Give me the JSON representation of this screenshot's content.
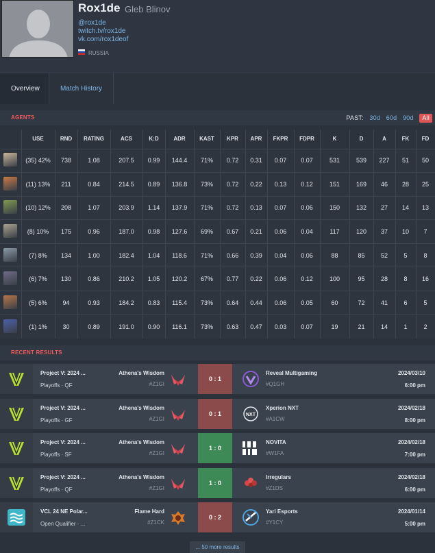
{
  "player": {
    "handle": "Rox1de",
    "real_name": "Gleb Blinov",
    "links": [
      "@rox1de",
      "twitch.tv/rox1de",
      "vk.com/rox1deof"
    ],
    "country": "RUSSIA"
  },
  "tabs": [
    {
      "label": "Overview",
      "active": true
    },
    {
      "label": "Match History",
      "active": false
    }
  ],
  "agents_section": {
    "title": "AGENTS",
    "past_label": "PAST:",
    "past_options": [
      "30d",
      "60d",
      "90d",
      "All"
    ],
    "selected": "All",
    "columns": [
      "USE",
      "RND",
      "RATING",
      "ACS",
      "K:D",
      "ADR",
      "KAST",
      "KPR",
      "APR",
      "FKPR",
      "FDPR",
      "K",
      "D",
      "A",
      "FK",
      "FD"
    ],
    "rows": [
      {
        "icon": "agent-1-icon",
        "color": "#c9b79a",
        "cells": [
          "(35) 42%",
          "738",
          "1.08",
          "207.5",
          "0.99",
          "144.4",
          "71%",
          "0.72",
          "0.31",
          "0.07",
          "0.07",
          "531",
          "539",
          "227",
          "51",
          "50"
        ]
      },
      {
        "icon": "agent-2-icon",
        "color": "#c97a45",
        "cells": [
          "(11) 13%",
          "211",
          "0.84",
          "214.5",
          "0.89",
          "136.8",
          "73%",
          "0.72",
          "0.22",
          "0.13",
          "0.12",
          "151",
          "169",
          "46",
          "28",
          "25"
        ]
      },
      {
        "icon": "agent-3-icon",
        "color": "#7f9a4f",
        "cells": [
          "(10) 12%",
          "208",
          "1.07",
          "203.9",
          "1.14",
          "137.9",
          "71%",
          "0.72",
          "0.13",
          "0.07",
          "0.06",
          "150",
          "132",
          "27",
          "14",
          "13"
        ]
      },
      {
        "icon": "agent-4-icon",
        "color": "#a9a28f",
        "cells": [
          "(8) 10%",
          "175",
          "0.96",
          "187.0",
          "0.98",
          "127.6",
          "69%",
          "0.67",
          "0.21",
          "0.06",
          "0.04",
          "117",
          "120",
          "37",
          "10",
          "7"
        ]
      },
      {
        "icon": "agent-5-icon",
        "color": "#8a9aa8",
        "cells": [
          "(7) 8%",
          "134",
          "1.00",
          "182.4",
          "1.04",
          "118.6",
          "71%",
          "0.66",
          "0.39",
          "0.04",
          "0.06",
          "88",
          "85",
          "52",
          "5",
          "8"
        ]
      },
      {
        "icon": "agent-6-icon",
        "color": "#6f6a86",
        "cells": [
          "(6) 7%",
          "130",
          "0.86",
          "210.2",
          "1.05",
          "120.2",
          "67%",
          "0.77",
          "0.22",
          "0.06",
          "0.12",
          "100",
          "95",
          "28",
          "8",
          "16"
        ]
      },
      {
        "icon": "agent-7-icon",
        "color": "#b7764a",
        "cells": [
          "(5) 6%",
          "94",
          "0.93",
          "184.2",
          "0.83",
          "115.4",
          "73%",
          "0.64",
          "0.44",
          "0.06",
          "0.05",
          "60",
          "72",
          "41",
          "6",
          "5"
        ]
      },
      {
        "icon": "agent-8-icon",
        "color": "#4c5fa8",
        "cells": [
          "(1) 1%",
          "30",
          "0.89",
          "191.0",
          "0.90",
          "116.1",
          "73%",
          "0.63",
          "0.47",
          "0.03",
          "0.07",
          "19",
          "21",
          "14",
          "1",
          "2"
        ]
      }
    ]
  },
  "results_section": {
    "title": "RECENT RESULTS",
    "results": [
      {
        "event": "Project V: 2024 ...",
        "stage": "Playoffs · QF",
        "team": "Athena's Wisdom",
        "team_tag": "#Z1GI",
        "score": "0 : 1",
        "outcome": "loss",
        "opponent": "Reveal Multigaming",
        "opp_tag": "#Q1GH",
        "date": "2024/03/10",
        "time": "6:00 pm",
        "event_logo": "project-v-logo",
        "opp_logo": "reveal-logo"
      },
      {
        "event": "Project V: 2024 ...",
        "stage": "Playoffs · GF",
        "team": "Athena's Wisdom",
        "team_tag": "#Z1GI",
        "score": "0 : 1",
        "outcome": "loss",
        "opponent": "Xperion NXT",
        "opp_tag": "#A1CW",
        "date": "2024/02/18",
        "time": "8:00 pm",
        "event_logo": "project-v-logo",
        "opp_logo": "nxt-logo"
      },
      {
        "event": "Project V: 2024 ...",
        "stage": "Playoffs · SF",
        "team": "Athena's Wisdom",
        "team_tag": "#Z1GI",
        "score": "1 : 0",
        "outcome": "win",
        "opponent": "NOVITA",
        "opp_tag": "#W1FA",
        "date": "2024/02/18",
        "time": "7:00 pm",
        "event_logo": "project-v-logo",
        "opp_logo": "novita-logo"
      },
      {
        "event": "Project V: 2024 ...",
        "stage": "Playoffs · QF",
        "team": "Athena's Wisdom",
        "team_tag": "#Z1GI",
        "score": "1 : 0",
        "outcome": "win",
        "opponent": "Irregulars",
        "opp_tag": "#Z1DS",
        "date": "2024/02/18",
        "time": "6:00 pm",
        "event_logo": "project-v-logo",
        "opp_logo": "irregulars-logo"
      },
      {
        "event": "VCL 24 NE Polar...",
        "stage": "Open Qualifier · ...",
        "team": "Flame Hard",
        "team_tag": "#Z1CK",
        "score": "0 : 2",
        "outcome": "loss",
        "opponent": "Yari Esports",
        "opp_tag": "#Y1CY",
        "date": "2024/01/14",
        "time": "5:00 pm",
        "event_logo": "vcl-logo",
        "opp_logo": "yari-logo"
      }
    ],
    "more_label": "... 50 more results"
  },
  "colors": {
    "accent": "#f05a5a",
    "link": "#7fb7e6",
    "win": "#3e8a56",
    "loss": "#8c4b4b",
    "project_v": "#b8e02e"
  }
}
